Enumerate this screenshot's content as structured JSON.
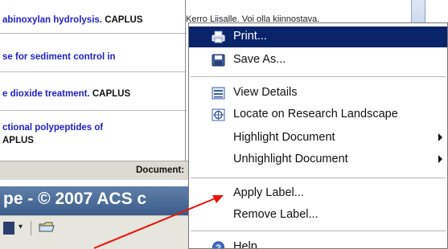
{
  "results_table": {
    "rows": [
      {
        "title": "abinoxylan hydrolysis.",
        "source": "CAPLUS",
        "note": "Kerro Liisalle. Voi olla kiinnostava."
      },
      {
        "title": "se for sediment control in",
        "source": ""
      },
      {
        "title": "e dioxide treatment.",
        "source": "CAPLUS"
      },
      {
        "title_line1": "ctional polypeptides of",
        "title_line2": "APLUS"
      }
    ]
  },
  "document_bar": {
    "label": "Document:"
  },
  "header": {
    "text": "pe - © 2007 ACS c"
  },
  "context_menu": {
    "items": [
      {
        "label": "Print...",
        "icon": "printer-icon",
        "active": true
      },
      {
        "label": "Save As...",
        "icon": "save-disk-icon"
      },
      {
        "label": "View Details",
        "icon": "details-list-icon"
      },
      {
        "label": "Locate on Research Landscape",
        "icon": "locate-crosshair-icon"
      },
      {
        "label": "Highlight Document",
        "submenu": true
      },
      {
        "label": "Unhighlight Document",
        "submenu": true
      },
      {
        "label": "Apply Label..."
      },
      {
        "label": "Remove Label..."
      },
      {
        "label": "Help",
        "icon": "help-icon"
      }
    ]
  },
  "colors": {
    "menu_highlight": "#0a246a",
    "link_text": "#1f1fc8",
    "header_band": "#4a6a96",
    "annotation_arrow": "#e8140c"
  }
}
